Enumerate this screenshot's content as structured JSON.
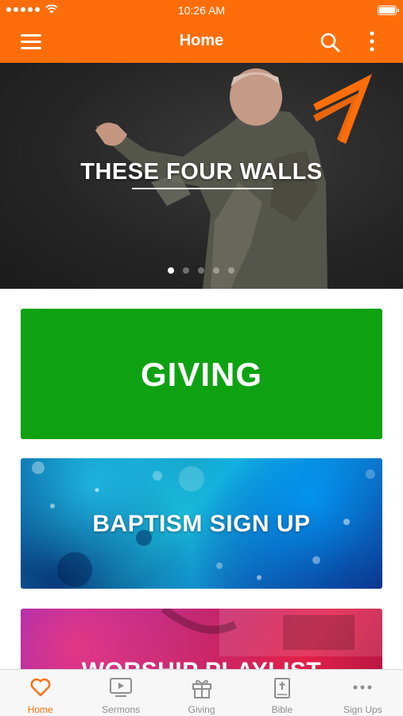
{
  "status_bar": {
    "time": "10:26 AM"
  },
  "header": {
    "title": "Home",
    "menu_icon": "hamburger-menu-icon",
    "search_icon": "search-icon",
    "more_icon": "more-vertical-icon"
  },
  "hero": {
    "title": "THESE FOUR WALLS",
    "slide_count": 5,
    "active_slide": 1
  },
  "cards": [
    {
      "label": "GIVING",
      "color": "#0ea212"
    },
    {
      "label": "BAPTISM SIGN UP",
      "color": "#18b6d6"
    },
    {
      "label": "WORSHIP PLAYLIST",
      "color": "#c2276f"
    }
  ],
  "tabs": [
    {
      "label": "Home",
      "icon": "heart-icon",
      "active": true
    },
    {
      "label": "Sermons",
      "icon": "play-tv-icon",
      "active": false
    },
    {
      "label": "Giving",
      "icon": "gift-icon",
      "active": false
    },
    {
      "label": "Bible",
      "icon": "bible-icon",
      "active": false
    },
    {
      "label": "Sign Ups",
      "icon": "more-horizontal-icon",
      "active": false
    }
  ],
  "colors": {
    "brand": "#fd6e0a",
    "tab_inactive": "#8e8e8e"
  }
}
